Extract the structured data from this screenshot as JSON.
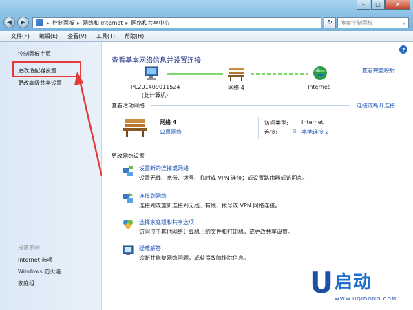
{
  "window": {
    "minimize": "–",
    "maximize": "□",
    "close": "✕"
  },
  "address": {
    "back": "◀",
    "forward": "▶",
    "crumbs": [
      "控制面板",
      "网络和 Internet",
      "网络和共享中心"
    ],
    "refresh": "↻",
    "search_placeholder": "搜索控制面板",
    "search_icon": "search-icon"
  },
  "menu": [
    "文件(F)",
    "编辑(E)",
    "查看(V)",
    "工具(T)",
    "帮助(H)"
  ],
  "sidebar": {
    "items": [
      "控制面板主页",
      "更改适配器设置",
      "更改高级共享设置"
    ],
    "see_also_header": "另请参阅",
    "see_also": [
      "Internet 选项",
      "Windows 防火墙",
      "家庭组"
    ]
  },
  "main": {
    "title": "查看基本网络信息并设置连接",
    "full_map": "查看完整映射",
    "nodes": {
      "computer_name": "PC201409011524",
      "computer_sub": "(此计算机)",
      "network_name": "网络  4",
      "internet": "Internet"
    },
    "active_section": "查看活动网络",
    "connect_disconnect": "连接或断开连接",
    "active": {
      "name": "网络 4",
      "type": "公用网络",
      "access_label": "访问类型:",
      "access_value": "Internet",
      "connection_label": "连接:",
      "connection_value": "本地连接 2"
    },
    "change_section": "更改网络设置",
    "settings": [
      {
        "title": "设置新的连接或网络",
        "desc": "设置无线、宽带、拨号、临时或 VPN 连接；或设置路由器或访问点。"
      },
      {
        "title": "连接到网络",
        "desc": "连接到或重新连接到无线、有线、拨号或 VPN 网络连接。"
      },
      {
        "title": "选择家庭组和共享选项",
        "desc": "访问位于其他网络计算机上的文件和打印机，或更改共享设置。"
      },
      {
        "title": "疑难解答",
        "desc": "诊断并修复网络问题，或获得故障排除信息。"
      }
    ]
  },
  "watermark": {
    "letter": "U",
    "brand": "启动",
    "url": "WWW.UQIDONG.COM"
  },
  "colors": {
    "link": "#2156b6",
    "annotation": "#e43a3a",
    "connector": "#7ed96b"
  }
}
